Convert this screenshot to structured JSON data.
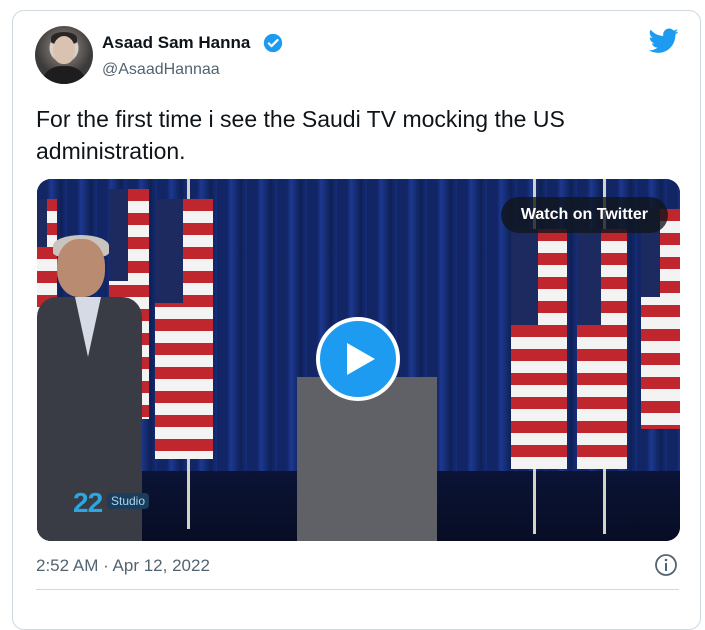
{
  "author": {
    "name": "Asaad Sam Hanna",
    "handle": "@AsaadHannaa",
    "verified": true
  },
  "tweet": {
    "text": "For the first time i see the Saudi TV mocking the US administration.",
    "timestamp": "2:52 AM · Apr 12, 2022"
  },
  "media": {
    "watch_label": "Watch on Twitter",
    "logo_number": "22",
    "logo_text": "Studio"
  },
  "icons": {
    "brand": "twitter-bird-icon",
    "verified": "verified-badge-icon",
    "play": "play-icon",
    "info": "info-icon"
  },
  "colors": {
    "accent": "#1d9bf0",
    "text": "#0f1419",
    "muted": "#536471",
    "border": "#cfd9de"
  }
}
